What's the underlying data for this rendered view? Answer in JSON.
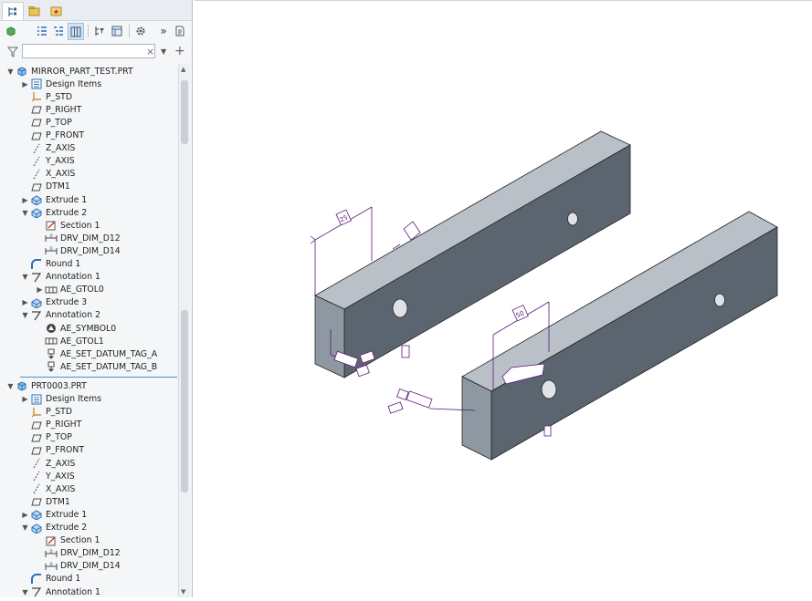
{
  "tabs": [
    {
      "name": "model-tree-tab",
      "icon": "tree-icon"
    },
    {
      "name": "folder-browser-tab",
      "icon": "folder-icon"
    },
    {
      "name": "favorites-tab",
      "icon": "star-icon"
    }
  ],
  "toolbar": {
    "more_label": "»"
  },
  "filter": {
    "value": "",
    "clear_label": "×",
    "add_label": "+"
  },
  "tree": {
    "rows": [
      {
        "label": "MIRROR_PART_TEST.PRT",
        "level": 0,
        "toggle": "▼",
        "icon": "part-icon"
      },
      {
        "label": "Design Items",
        "level": 1,
        "toggle": "▶",
        "icon": "design-items-icon"
      },
      {
        "label": "P_STD",
        "level": 1,
        "toggle": "",
        "icon": "csys-icon"
      },
      {
        "label": "P_RIGHT",
        "level": 1,
        "toggle": "",
        "icon": "datum-plane-icon"
      },
      {
        "label": "P_TOP",
        "level": 1,
        "toggle": "",
        "icon": "datum-plane-icon"
      },
      {
        "label": "P_FRONT",
        "level": 1,
        "toggle": "",
        "icon": "datum-plane-icon"
      },
      {
        "label": "Z_AXIS",
        "level": 1,
        "toggle": "",
        "icon": "axis-icon"
      },
      {
        "label": "Y_AXIS",
        "level": 1,
        "toggle": "",
        "icon": "axis-icon"
      },
      {
        "label": "X_AXIS",
        "level": 1,
        "toggle": "",
        "icon": "axis-icon"
      },
      {
        "label": "DTM1",
        "level": 1,
        "toggle": "",
        "icon": "datum-plane-icon"
      },
      {
        "label": "Extrude 1",
        "level": 1,
        "toggle": "▶",
        "icon": "extrude-icon"
      },
      {
        "label": "Extrude 2",
        "level": 1,
        "toggle": "▼",
        "icon": "extrude-icon"
      },
      {
        "label": "Section 1",
        "level": 2,
        "toggle": "",
        "icon": "sketch-icon"
      },
      {
        "label": "DRV_DIM_D12",
        "level": 2,
        "toggle": "",
        "icon": "dimension-icon"
      },
      {
        "label": "DRV_DIM_D14",
        "level": 2,
        "toggle": "",
        "icon": "dimension-icon"
      },
      {
        "label": "Round 1",
        "level": 1,
        "toggle": "",
        "icon": "round-icon"
      },
      {
        "label": "Annotation 1",
        "level": 1,
        "toggle": "▼",
        "icon": "annotation-icon"
      },
      {
        "label": "AE_GTOL0",
        "level": 2,
        "toggle": "▶",
        "icon": "gtol-icon"
      },
      {
        "label": "Extrude 3",
        "level": 1,
        "toggle": "▶",
        "icon": "extrude-icon"
      },
      {
        "label": "Annotation 2",
        "level": 1,
        "toggle": "▼",
        "icon": "annotation-icon"
      },
      {
        "label": "AE_SYMBOL0",
        "level": 2,
        "toggle": "",
        "icon": "symbol-icon"
      },
      {
        "label": "AE_GTOL1",
        "level": 2,
        "toggle": "",
        "icon": "gtol-icon"
      },
      {
        "label": "AE_SET_DATUM_TAG_A",
        "level": 2,
        "toggle": "",
        "icon": "datum-tag-icon"
      },
      {
        "label": "AE_SET_DATUM_TAG_B",
        "level": 2,
        "toggle": "",
        "icon": "datum-tag-icon"
      },
      {
        "label": "PRT0003.PRT",
        "level": 0,
        "toggle": "▼",
        "icon": "part-icon"
      },
      {
        "label": "Design Items",
        "level": 1,
        "toggle": "▶",
        "icon": "design-items-icon"
      },
      {
        "label": "P_STD",
        "level": 1,
        "toggle": "",
        "icon": "csys-icon"
      },
      {
        "label": "P_RIGHT",
        "level": 1,
        "toggle": "",
        "icon": "datum-plane-icon"
      },
      {
        "label": "P_TOP",
        "level": 1,
        "toggle": "",
        "icon": "datum-plane-icon"
      },
      {
        "label": "P_FRONT",
        "level": 1,
        "toggle": "",
        "icon": "datum-plane-icon"
      },
      {
        "label": "Z_AXIS",
        "level": 1,
        "toggle": "",
        "icon": "axis-icon"
      },
      {
        "label": "Y_AXIS",
        "level": 1,
        "toggle": "",
        "icon": "axis-icon"
      },
      {
        "label": "X_AXIS",
        "level": 1,
        "toggle": "",
        "icon": "axis-icon"
      },
      {
        "label": "DTM1",
        "level": 1,
        "toggle": "",
        "icon": "datum-plane-icon"
      },
      {
        "label": "Extrude 1",
        "level": 1,
        "toggle": "▶",
        "icon": "extrude-icon"
      },
      {
        "label": "Extrude 2",
        "level": 1,
        "toggle": "▼",
        "icon": "extrude-icon"
      },
      {
        "label": "Section 1",
        "level": 2,
        "toggle": "",
        "icon": "sketch-icon"
      },
      {
        "label": "DRV_DIM_D12",
        "level": 2,
        "toggle": "",
        "icon": "dimension-icon"
      },
      {
        "label": "DRV_DIM_D14",
        "level": 2,
        "toggle": "",
        "icon": "dimension-icon"
      },
      {
        "label": "Round 1",
        "level": 1,
        "toggle": "",
        "icon": "round-icon"
      },
      {
        "label": "Annotation 1",
        "level": 1,
        "toggle": "▼",
        "icon": "annotation-icon"
      }
    ]
  },
  "colors": {
    "panel_bg": "#f4f6f8",
    "accent": "#4a8fd8",
    "model_top": "#b9c0c8",
    "model_front": "#5b6570",
    "model_side": "#8e98a2",
    "annotation": "#5a1a7a"
  },
  "viewport": {
    "annotations": [
      "25",
      "50"
    ]
  }
}
